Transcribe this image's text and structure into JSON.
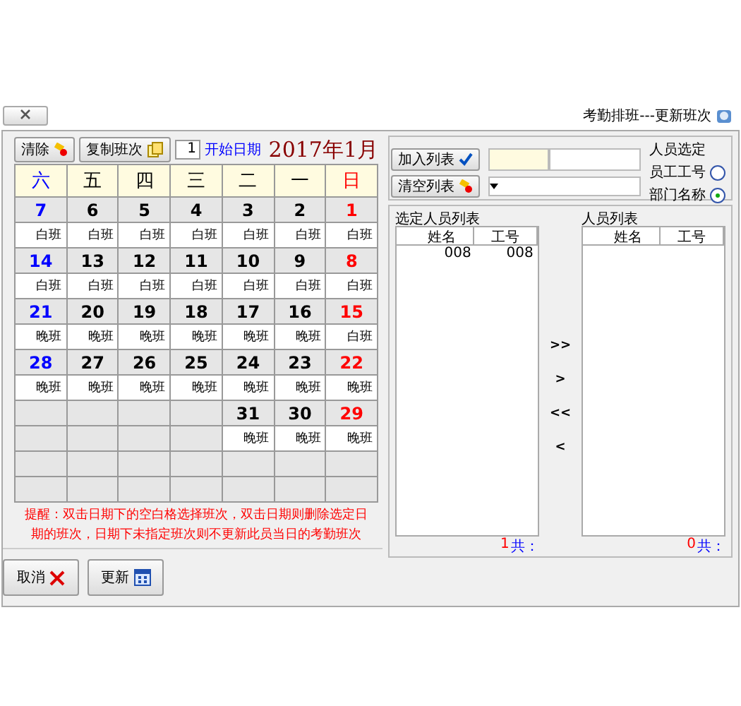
{
  "window": {
    "title": "考勤排班---更新班次"
  },
  "person_select": {
    "title": "人员选定",
    "radios": [
      {
        "label": "员工工号",
        "selected": false
      },
      {
        "label": "部门名称",
        "selected": true
      }
    ],
    "buttons": [
      "加入列表",
      "清空列表"
    ]
  },
  "people_list": {
    "title": "人员列表",
    "columns": [
      "姓名",
      "工号"
    ],
    "count_label": "共：",
    "count": "0"
  },
  "move_buttons": [
    ">>",
    ">",
    "<<",
    "<"
  ],
  "selected_list": {
    "title": "选定人员列表",
    "columns": [
      "姓名",
      "工号"
    ],
    "rows": [
      [
        "008",
        "008"
      ]
    ],
    "count_label": "共：",
    "count": "1"
  },
  "calendar": {
    "month": "2017年1月",
    "start_label": "开始日期",
    "start_value": "1",
    "buttons": [
      "清除",
      "复制班次"
    ],
    "weekdays": [
      {
        "label": "六",
        "color": "#0000ff"
      },
      {
        "label": "五",
        "color": "#000000"
      },
      {
        "label": "四",
        "color": "#000000"
      },
      {
        "label": "三",
        "color": "#000000"
      },
      {
        "label": "二",
        "color": "#000000"
      },
      {
        "label": "一",
        "color": "#000000"
      },
      {
        "label": "日",
        "color": "#ff0000"
      }
    ],
    "weeks": [
      [
        {
          "date": "7",
          "shift": "白班"
        },
        {
          "date": "6",
          "shift": "白班"
        },
        {
          "date": "5",
          "shift": "白班"
        },
        {
          "date": "4",
          "shift": "白班"
        },
        {
          "date": "3",
          "shift": "白班"
        },
        {
          "date": "2",
          "shift": "白班"
        },
        {
          "date": "1",
          "shift": "白班"
        }
      ],
      [
        {
          "date": "14",
          "shift": "白班"
        },
        {
          "date": "13",
          "shift": "白班"
        },
        {
          "date": "12",
          "shift": "白班"
        },
        {
          "date": "11",
          "shift": "白班"
        },
        {
          "date": "10",
          "shift": "白班"
        },
        {
          "date": "9",
          "shift": "白班"
        },
        {
          "date": "8",
          "shift": "白班"
        }
      ],
      [
        {
          "date": "21",
          "shift": "晚班"
        },
        {
          "date": "20",
          "shift": "晚班"
        },
        {
          "date": "19",
          "shift": "晚班"
        },
        {
          "date": "18",
          "shift": "晚班"
        },
        {
          "date": "17",
          "shift": "晚班"
        },
        {
          "date": "16",
          "shift": "晚班"
        },
        {
          "date": "15",
          "shift": "白班"
        }
      ],
      [
        {
          "date": "28",
          "shift": "晚班"
        },
        {
          "date": "27",
          "shift": "晚班"
        },
        {
          "date": "26",
          "shift": "晚班"
        },
        {
          "date": "25",
          "shift": "晚班"
        },
        {
          "date": "24",
          "shift": "晚班"
        },
        {
          "date": "23",
          "shift": "晚班"
        },
        {
          "date": "22",
          "shift": "晚班"
        }
      ],
      [
        {
          "empty": true
        },
        {
          "empty": true
        },
        {
          "empty": true
        },
        {
          "empty": true
        },
        {
          "date": "31",
          "shift": "晚班"
        },
        {
          "date": "30",
          "shift": "晚班"
        },
        {
          "date": "29",
          "shift": "晚班"
        }
      ],
      [
        {
          "empty": true
        },
        {
          "empty": true
        },
        {
          "empty": true
        },
        {
          "empty": true
        },
        {
          "empty": true
        },
        {
          "empty": true
        },
        {
          "empty": true
        }
      ]
    ],
    "note": "提醒：双击日期下的空白格选择班次，双击日期则删除选定日期的班次，日期下未指定班次则不更新此员当日的考勤班次"
  },
  "footer_buttons": [
    "取消",
    "更新"
  ]
}
